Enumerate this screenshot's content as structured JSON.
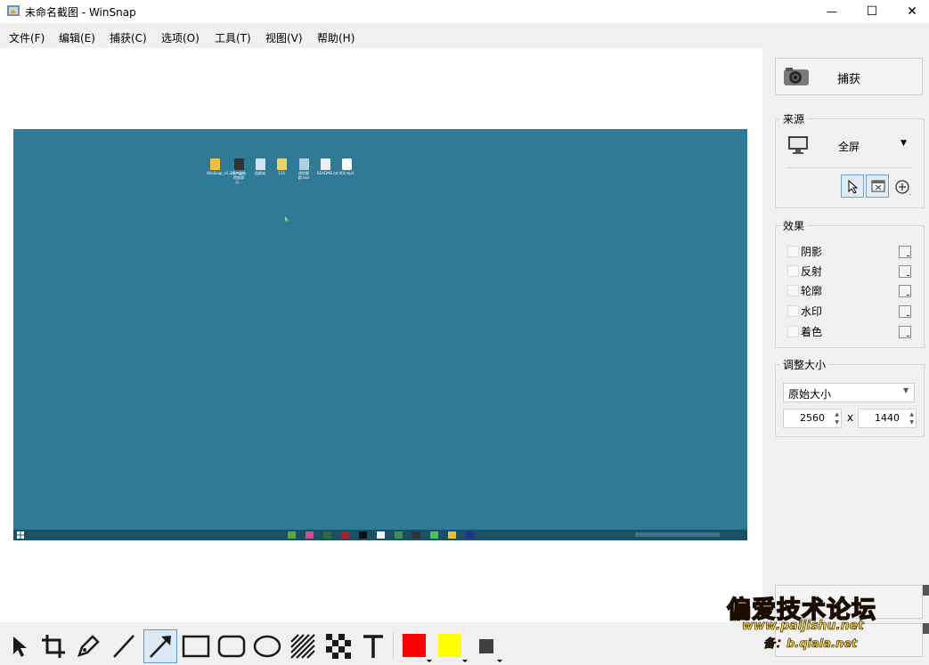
{
  "window": {
    "title": "未命名截图 - WinSnap",
    "minimize_glyph": "—",
    "maximize_glyph": "☐",
    "close_glyph": "✕"
  },
  "menu": [
    "文件(F)",
    "编辑(E)",
    "捕获(C)",
    "选项(O)",
    "工具(T)",
    "视图(V)",
    "帮助(H)"
  ],
  "capture_button": {
    "label": "捕获",
    "icon": "camera-icon"
  },
  "source": {
    "legend": "来源",
    "mode": "全屏",
    "icon": "monitor-icon"
  },
  "effects": {
    "legend": "效果",
    "items": [
      {
        "label": "阴影",
        "checked": false
      },
      {
        "label": "反射",
        "checked": false
      },
      {
        "label": "轮廓",
        "checked": false
      },
      {
        "label": "水印",
        "checked": false
      },
      {
        "label": "着色",
        "checked": false
      }
    ]
  },
  "resize": {
    "legend": "调整大小",
    "mode": "原始大小",
    "width": "2560",
    "sep": "x",
    "height": "1440"
  },
  "desktop_icons": [
    "WinSnap_v5.3.6.exe",
    "打产品和特效演示...",
    "回收站",
    "123",
    "质检跟踪.exe",
    "README.txt",
    "dfd.mp3"
  ],
  "tools": [
    "select",
    "crop",
    "pen",
    "line",
    "arrow",
    "rectangle",
    "rounded-rectangle",
    "ellipse",
    "hatch",
    "pixelate",
    "text"
  ],
  "selected_tool": "arrow",
  "colors": {
    "primary": "#ff0000",
    "secondary": "#ffff00",
    "fill": "#404040",
    "desktop": "#2e7a97"
  },
  "watermark": {
    "title": "偏爱技术论坛",
    "url": "www.paijishu.net",
    "backup": "备：b.qiala.net"
  }
}
